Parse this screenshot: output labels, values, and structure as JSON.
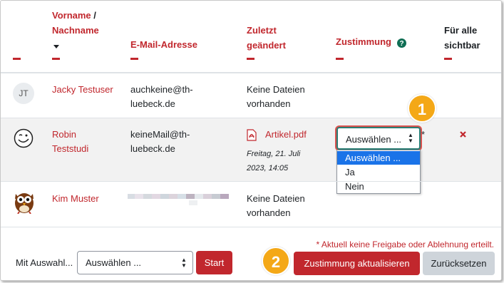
{
  "headers": {
    "name_first": "Vorname",
    "name_sep": " /",
    "name_last": "Nachname",
    "email": "E-Mail-Adresse",
    "changed_line1": "Zuletzt",
    "changed_line2": "geändert",
    "consent": "Zustimmung",
    "visible_line1": "Für alle",
    "visible_line2": "sichtbar"
  },
  "rows": [
    {
      "avatar_initials": "JT",
      "name": "Jacky Testuser",
      "email_line1": "auchkeine@th-",
      "email_line2": "luebeck.de",
      "file_line1": "Keine Dateien",
      "file_line2": "vorhanden"
    },
    {
      "name_line1": "Robin",
      "name_line2": "Teststudi",
      "email_line1": "keineMail@th-",
      "email_line2": "luebeck.de",
      "file_name": "Artikel.pdf",
      "date_line1": "Freitag, 21. Juli",
      "date_line2": "2023, 14:05",
      "consent_select": "Auswählen ...",
      "asterisk": "*",
      "options": [
        "Auswählen ...",
        "Ja",
        "Nein"
      ]
    },
    {
      "name": "Kim Muster",
      "file_line1": "Keine Dateien",
      "file_line2": "vorhanden"
    }
  ],
  "footer": {
    "note": "* Aktuell keine Freigabe oder Ablehnung erteilt.",
    "bulk_label": "Mit Auswahl...",
    "bulk_select": "Auswählen ...",
    "start_button": "Start",
    "update_button": "Zustimmung aktualisieren",
    "reset_button": "Zurücksetzen"
  },
  "callouts": {
    "one": "1",
    "two": "2"
  },
  "colors": {
    "accent": "#c1272d",
    "callout": "#f4a817",
    "highlight": "#1a73e8"
  },
  "icons": [
    "sort-down-icon",
    "help-icon",
    "pdf-icon",
    "delete-x-icon",
    "select-caret-icon"
  ]
}
